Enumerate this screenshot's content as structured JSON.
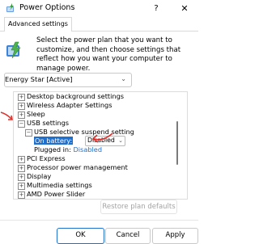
{
  "window": {
    "title": "Power Options",
    "help_glyph": "?",
    "close_glyph": "✕"
  },
  "tabs": [
    {
      "label": "Advanced settings"
    }
  ],
  "intro": {
    "text": "Select the power plan that you want to customize, and then choose settings that reflect how you want your computer to manage power.",
    "icon": "power-plan-icon"
  },
  "plan_select": {
    "value": "Energy Star [Active]"
  },
  "tree": [
    {
      "label": "Desktop background settings",
      "expander": "+"
    },
    {
      "label": "Wireless Adapter Settings",
      "expander": "+"
    },
    {
      "label": "Sleep",
      "expander": "+"
    },
    {
      "label": "USB settings",
      "expander": "−"
    },
    {
      "label": "USB selective suspend setting",
      "expander": "−"
    },
    {
      "label": "On battery:",
      "value": "Disabled"
    },
    {
      "label": "Plugged in:",
      "value": "Disabled"
    },
    {
      "label": "PCI Express",
      "expander": "+"
    },
    {
      "label": "Processor power management",
      "expander": "+"
    },
    {
      "label": "Display",
      "expander": "+"
    },
    {
      "label": "Multimedia settings",
      "expander": "+"
    },
    {
      "label": "AMD Power Slider",
      "expander": "+"
    }
  ],
  "buttons": {
    "restore": "Restore plan defaults",
    "ok": "OK",
    "cancel": "Cancel",
    "apply": "Apply"
  },
  "colors": {
    "accent": "#1f6fce",
    "annotation": "#e0322d"
  },
  "icons": {
    "chevron": "⌄"
  }
}
